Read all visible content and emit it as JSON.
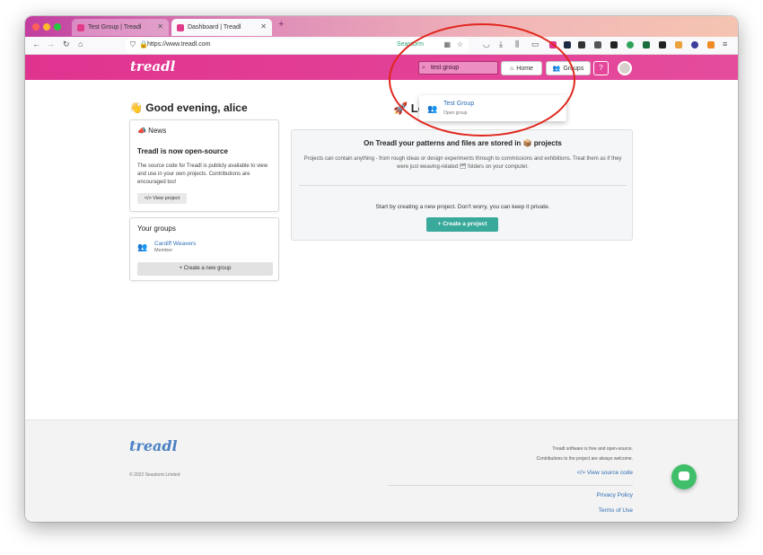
{
  "browser": {
    "tabs": [
      {
        "label": "Test Group | Treadl",
        "active": false
      },
      {
        "label": "Dashboard | Treadl",
        "active": true
      }
    ],
    "url": "https://www.treadl.com",
    "container_label": "Seastorm"
  },
  "header": {
    "logo": "treadl",
    "search_value": "test group",
    "home_label": "Home",
    "groups_label": "Groups",
    "help_label": "?"
  },
  "search_dropdown": {
    "title": "Test Group",
    "subtitle": "Open group"
  },
  "sidebar": {
    "greeting": "👋 Good evening, alice",
    "news": {
      "title": "📣 News",
      "headline": "Treadl is now open-source",
      "body": "The source code for Treadl is publicly available to view and use in your own projects. Contributions are encouraged too!",
      "button": "</> View project"
    },
    "groups": {
      "title": "Your groups",
      "items": [
        {
          "name": "Cardiff Weavers",
          "role": "Member"
        }
      ],
      "new_group_button": "+ Create a new group"
    }
  },
  "main": {
    "hero": "🚀 Let's get started, alice!",
    "panel_heading": "On Treadl your patterns and files are stored in 📦 projects",
    "panel_text": "Projects can contain anything - from rough ideas or design experiments through to commissions and exhibitions. Treat them as if they were just weaving-related 🗂 folders on your computer.",
    "panel_cta_text": "Start by creating a new project. Don't worry, you can keep it private.",
    "create_button": "+ Create a project"
  },
  "footer": {
    "logo": "treadl",
    "copyright": "© 2022 Seastorm Limited",
    "line1": "Treadl software is free and open-source.",
    "line2": "Contributions to the project are always welcome.",
    "source_link": "</> View source code",
    "privacy_link": "Privacy Policy",
    "terms_link": "Terms of Use"
  },
  "colors": {
    "brand": "#e0338f",
    "accent": "#39a99b",
    "link": "#2f6fb5",
    "annotation": "#e0261c"
  }
}
